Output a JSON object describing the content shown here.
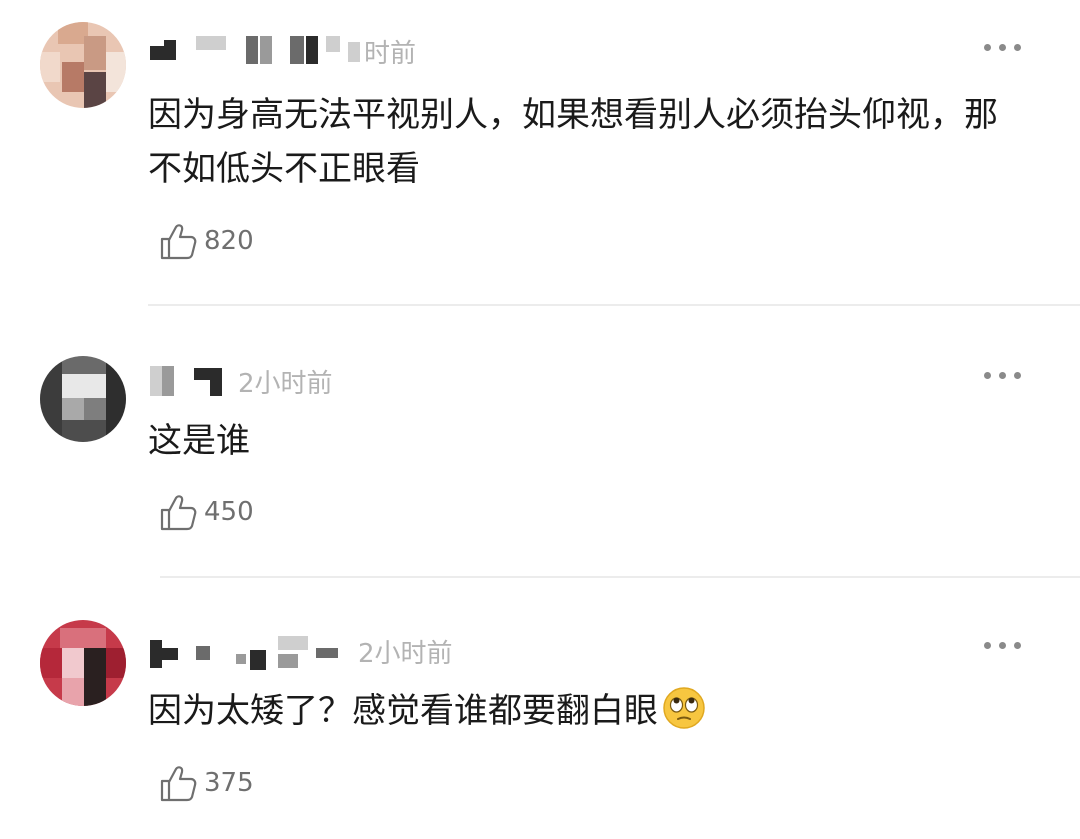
{
  "comments": [
    {
      "time": "时前",
      "text": "因为身高无法平视别人，如果想看别人必须抬头仰视，那不如低头不正眼看",
      "likes": "820",
      "like_icon": "thumbs-up-icon",
      "more_icon": "more-dots-icon"
    },
    {
      "time": "2小时前",
      "text": "这是谁",
      "likes": "450",
      "like_icon": "thumbs-up-icon",
      "more_icon": "more-dots-icon"
    },
    {
      "time": "2小时前",
      "text": "因为太矮了？感觉看谁都要翻白眼",
      "emoji": "eye-roll-emoji-icon",
      "likes": "375",
      "like_icon": "thumbs-up-icon",
      "more_icon": "more-dots-icon"
    }
  ]
}
